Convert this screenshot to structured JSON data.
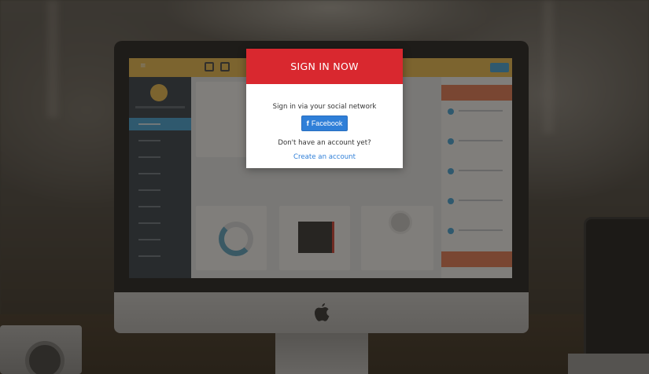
{
  "modal": {
    "title": "SIGN IN NOW",
    "prompt": "Sign in via your social network",
    "facebook_button": {
      "icon": "facebook-icon",
      "glyph": "f",
      "label": "Facebook",
      "color": "#2f7fd8"
    },
    "no_account_text": "Don't have an account yet?",
    "create_account_link": "Create an account",
    "header_color": "#d9282f"
  },
  "background_device": {
    "computer": "iMac",
    "logo_icon": "apple-icon"
  }
}
